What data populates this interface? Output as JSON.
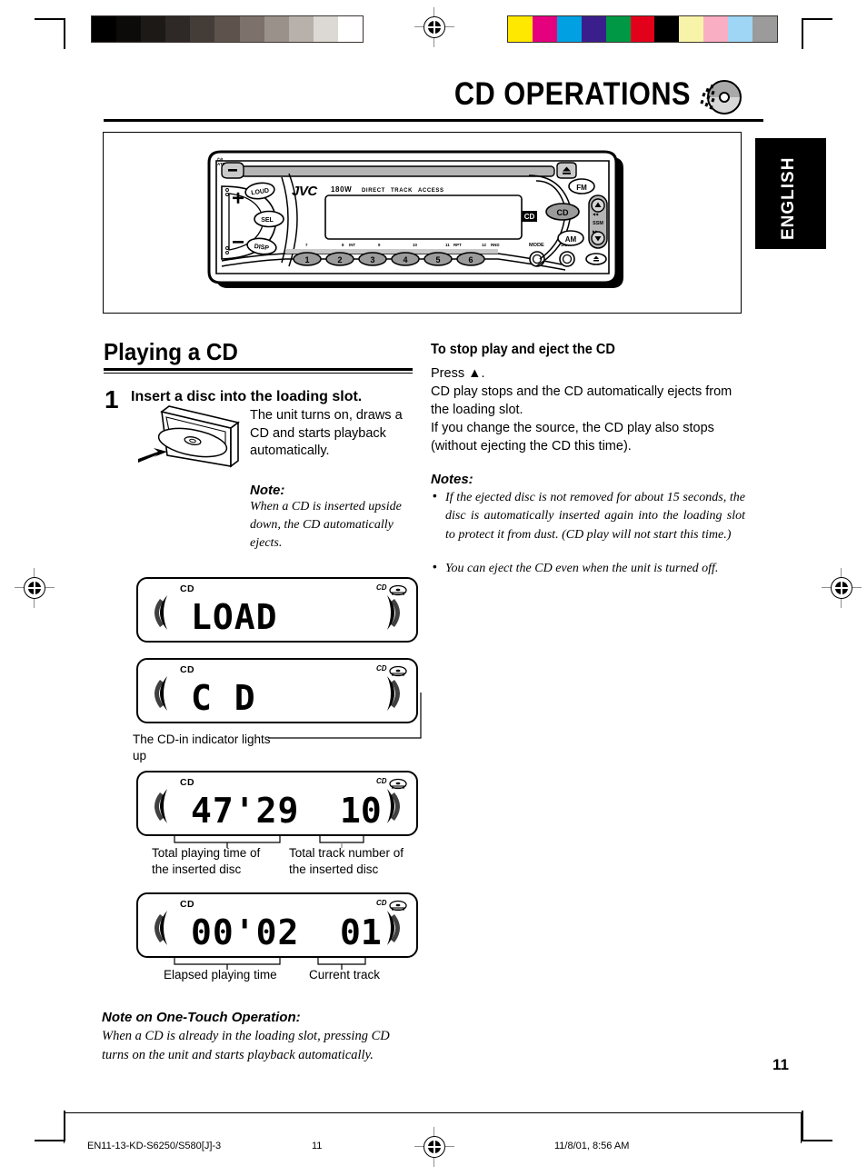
{
  "header": {
    "title": "CD OPERATIONS",
    "cd_icon": "cd-disc-icon",
    "language_tab": "ENGLISH"
  },
  "unit_illustration": {
    "brand": "JVC",
    "power_label": "180W",
    "feature_labels": [
      "DIRECT",
      "TRACK",
      "ACCESS"
    ],
    "standby_label": "ATT",
    "left_buttons": [
      "LOUD",
      "SEL",
      "DISP"
    ],
    "volume_plus": "+",
    "volume_minus": "−",
    "source_buttons": [
      "FM",
      "CD",
      "AM"
    ],
    "ssm_label": "SSM",
    "bottom_buttons": [
      "MODE",
      "SCM"
    ],
    "preset_numbers": [
      "1",
      "2",
      "3",
      "4",
      "5",
      "6"
    ],
    "preset_sub_labels": [
      "7",
      "8  INT",
      "9",
      "10",
      "11  RPT",
      "12  RND"
    ],
    "logo_mark": "compact-disc-digital-audio"
  },
  "left_column": {
    "heading": "Playing a CD",
    "step_number": "1",
    "step_title": "Insert a disc into the loading slot.",
    "step_body": "The unit turns on, draws a CD and starts playback automatically.",
    "note_heading": "Note:",
    "note_body": "When a CD is inserted upside down, the CD automatically ejects.",
    "displays": [
      {
        "name": "load-display",
        "cd_label": "CD",
        "main": "LOAD",
        "track": ""
      },
      {
        "name": "cd-display",
        "cd_label": "CD",
        "main": "C     D",
        "track": ""
      },
      {
        "name": "total-time-display",
        "cd_label": "CD",
        "main": "47'29",
        "track": "10"
      },
      {
        "name": "elapsed-time-display",
        "cd_label": "CD",
        "main": "00'02",
        "track": "01"
      }
    ],
    "cd_in_caption": "The CD-in indicator lights up",
    "caption_total_time": "Total playing time of the inserted disc",
    "caption_total_track": "Total track number of the inserted disc",
    "caption_elapsed": "Elapsed playing time",
    "caption_current_track": "Current track",
    "onetouch_heading": "Note on One-Touch Operation:",
    "onetouch_body": "When a CD is already in the loading slot, pressing CD turns on the unit and starts playback automatically."
  },
  "right_column": {
    "heading": "To stop play and eject the CD",
    "para1": "Press ▲.",
    "para2": "CD play stops and the CD automatically ejects from the loading slot.",
    "para3": "If you change the source, the CD play also stops (without ejecting the CD this time).",
    "notes_heading": "Notes:",
    "notes": [
      "If the ejected disc is not removed for about 15 seconds, the disc is automatically inserted again into the loading slot to protect it from dust. (CD play will not start this time.)",
      "You can eject the CD even when the unit is turned off."
    ]
  },
  "footer": {
    "file_id": "EN11-13-KD-S6250/S580[J]-3",
    "sheet_number": "11",
    "timestamp": "11/8/01, 8:56 AM",
    "page_number": "11"
  },
  "print_marks": {
    "gray_ramp": [
      "#000000",
      "#0d0b0a",
      "#1c1917",
      "#2e2926",
      "#443c37",
      "#5d534c",
      "#7c726b",
      "#9a918a",
      "#b8b1ab",
      "#dcd9d5",
      "#ffffff"
    ],
    "color_bar": [
      "#ffe800",
      "#e5007e",
      "#00a0e2",
      "#3a1f8c",
      "#009844",
      "#e2001a",
      "#000000",
      "#f7f3a8",
      "#f9aec4",
      "#9fd6f5",
      "#9b9b9b"
    ]
  }
}
